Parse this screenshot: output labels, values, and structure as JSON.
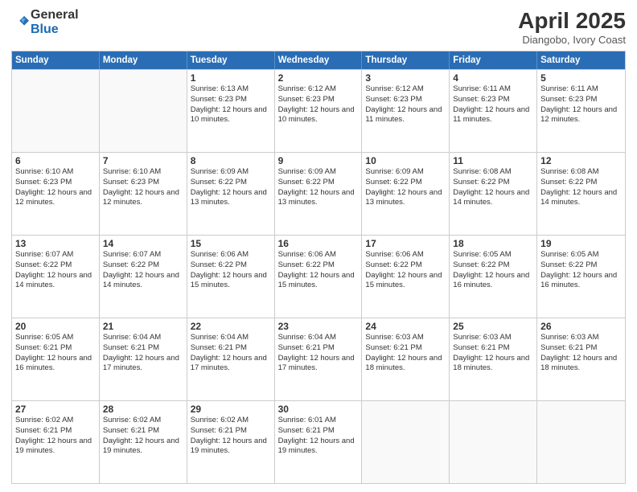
{
  "logo": {
    "general": "General",
    "blue": "Blue"
  },
  "title": {
    "month": "April 2025",
    "location": "Diangobo, Ivory Coast"
  },
  "header_days": [
    "Sunday",
    "Monday",
    "Tuesday",
    "Wednesday",
    "Thursday",
    "Friday",
    "Saturday"
  ],
  "weeks": [
    [
      {
        "day": "",
        "info": ""
      },
      {
        "day": "",
        "info": ""
      },
      {
        "day": "1",
        "info": "Sunrise: 6:13 AM\nSunset: 6:23 PM\nDaylight: 12 hours and 10 minutes."
      },
      {
        "day": "2",
        "info": "Sunrise: 6:12 AM\nSunset: 6:23 PM\nDaylight: 12 hours and 10 minutes."
      },
      {
        "day": "3",
        "info": "Sunrise: 6:12 AM\nSunset: 6:23 PM\nDaylight: 12 hours and 11 minutes."
      },
      {
        "day": "4",
        "info": "Sunrise: 6:11 AM\nSunset: 6:23 PM\nDaylight: 12 hours and 11 minutes."
      },
      {
        "day": "5",
        "info": "Sunrise: 6:11 AM\nSunset: 6:23 PM\nDaylight: 12 hours and 12 minutes."
      }
    ],
    [
      {
        "day": "6",
        "info": "Sunrise: 6:10 AM\nSunset: 6:23 PM\nDaylight: 12 hours and 12 minutes."
      },
      {
        "day": "7",
        "info": "Sunrise: 6:10 AM\nSunset: 6:23 PM\nDaylight: 12 hours and 12 minutes."
      },
      {
        "day": "8",
        "info": "Sunrise: 6:09 AM\nSunset: 6:22 PM\nDaylight: 12 hours and 13 minutes."
      },
      {
        "day": "9",
        "info": "Sunrise: 6:09 AM\nSunset: 6:22 PM\nDaylight: 12 hours and 13 minutes."
      },
      {
        "day": "10",
        "info": "Sunrise: 6:09 AM\nSunset: 6:22 PM\nDaylight: 12 hours and 13 minutes."
      },
      {
        "day": "11",
        "info": "Sunrise: 6:08 AM\nSunset: 6:22 PM\nDaylight: 12 hours and 14 minutes."
      },
      {
        "day": "12",
        "info": "Sunrise: 6:08 AM\nSunset: 6:22 PM\nDaylight: 12 hours and 14 minutes."
      }
    ],
    [
      {
        "day": "13",
        "info": "Sunrise: 6:07 AM\nSunset: 6:22 PM\nDaylight: 12 hours and 14 minutes."
      },
      {
        "day": "14",
        "info": "Sunrise: 6:07 AM\nSunset: 6:22 PM\nDaylight: 12 hours and 14 minutes."
      },
      {
        "day": "15",
        "info": "Sunrise: 6:06 AM\nSunset: 6:22 PM\nDaylight: 12 hours and 15 minutes."
      },
      {
        "day": "16",
        "info": "Sunrise: 6:06 AM\nSunset: 6:22 PM\nDaylight: 12 hours and 15 minutes."
      },
      {
        "day": "17",
        "info": "Sunrise: 6:06 AM\nSunset: 6:22 PM\nDaylight: 12 hours and 15 minutes."
      },
      {
        "day": "18",
        "info": "Sunrise: 6:05 AM\nSunset: 6:22 PM\nDaylight: 12 hours and 16 minutes."
      },
      {
        "day": "19",
        "info": "Sunrise: 6:05 AM\nSunset: 6:22 PM\nDaylight: 12 hours and 16 minutes."
      }
    ],
    [
      {
        "day": "20",
        "info": "Sunrise: 6:05 AM\nSunset: 6:21 PM\nDaylight: 12 hours and 16 minutes."
      },
      {
        "day": "21",
        "info": "Sunrise: 6:04 AM\nSunset: 6:21 PM\nDaylight: 12 hours and 17 minutes."
      },
      {
        "day": "22",
        "info": "Sunrise: 6:04 AM\nSunset: 6:21 PM\nDaylight: 12 hours and 17 minutes."
      },
      {
        "day": "23",
        "info": "Sunrise: 6:04 AM\nSunset: 6:21 PM\nDaylight: 12 hours and 17 minutes."
      },
      {
        "day": "24",
        "info": "Sunrise: 6:03 AM\nSunset: 6:21 PM\nDaylight: 12 hours and 18 minutes."
      },
      {
        "day": "25",
        "info": "Sunrise: 6:03 AM\nSunset: 6:21 PM\nDaylight: 12 hours and 18 minutes."
      },
      {
        "day": "26",
        "info": "Sunrise: 6:03 AM\nSunset: 6:21 PM\nDaylight: 12 hours and 18 minutes."
      }
    ],
    [
      {
        "day": "27",
        "info": "Sunrise: 6:02 AM\nSunset: 6:21 PM\nDaylight: 12 hours and 19 minutes."
      },
      {
        "day": "28",
        "info": "Sunrise: 6:02 AM\nSunset: 6:21 PM\nDaylight: 12 hours and 19 minutes."
      },
      {
        "day": "29",
        "info": "Sunrise: 6:02 AM\nSunset: 6:21 PM\nDaylight: 12 hours and 19 minutes."
      },
      {
        "day": "30",
        "info": "Sunrise: 6:01 AM\nSunset: 6:21 PM\nDaylight: 12 hours and 19 minutes."
      },
      {
        "day": "",
        "info": ""
      },
      {
        "day": "",
        "info": ""
      },
      {
        "day": "",
        "info": ""
      }
    ]
  ]
}
